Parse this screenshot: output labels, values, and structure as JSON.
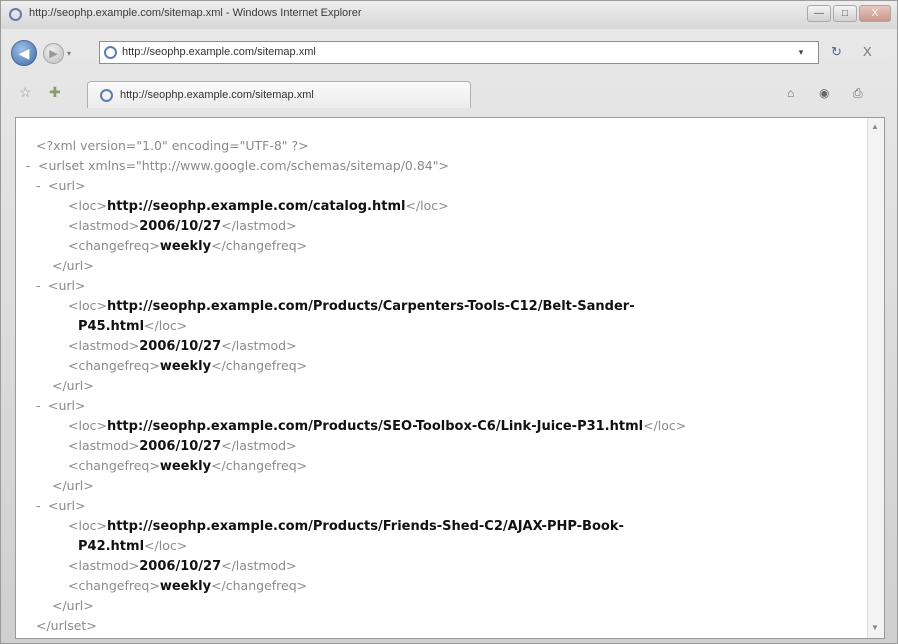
{
  "window": {
    "title": "http://seophp.example.com/sitemap.xml - Windows Internet Explorer",
    "minimize": "—",
    "maximize": "□",
    "close": "X"
  },
  "nav": {
    "back": "◀",
    "forward": "▶",
    "history": "▾",
    "address": "http://seophp.example.com/sitemap.xml",
    "address_dropdown": "▾",
    "refresh": "↻",
    "stop": "X"
  },
  "tabs": {
    "favorites": "☆",
    "add_favorites": "✚",
    "active_label": "http://seophp.example.com/sitemap.xml",
    "home": "⌂",
    "feeds": "◉",
    "print": "⎙"
  },
  "xml": {
    "decl": "<?xml version=\"1.0\" encoding=\"UTF-8\" ?>",
    "urlset_open": "<urlset xmlns=\"http://www.google.com/schemas/sitemap/0.84\">",
    "urlset_close": "</urlset>",
    "url_open": "<url>",
    "url_close": "</url>",
    "loc_open": "<loc>",
    "loc_close": "</loc>",
    "lastmod_open": "<lastmod>",
    "lastmod_close": "</lastmod>",
    "changefreq_open": "<changefreq>",
    "changefreq_close": "</changefreq>",
    "urls": [
      {
        "loc": "http://seophp.example.com/catalog.html",
        "lastmod": "2006/10/27",
        "changefreq": "weekly"
      },
      {
        "loc": "http://seophp.example.com/Products/Carpenters-Tools-C12/Belt-Sander-",
        "loc_cont": "P45.html",
        "lastmod": "2006/10/27",
        "changefreq": "weekly"
      },
      {
        "loc": "http://seophp.example.com/Products/SEO-Toolbox-C6/Link-Juice-P31.html",
        "lastmod": "2006/10/27",
        "changefreq": "weekly"
      },
      {
        "loc": "http://seophp.example.com/Products/Friends-Shed-C2/AJAX-PHP-Book-",
        "loc_cont": "P42.html",
        "lastmod": "2006/10/27",
        "changefreq": "weekly"
      }
    ]
  }
}
